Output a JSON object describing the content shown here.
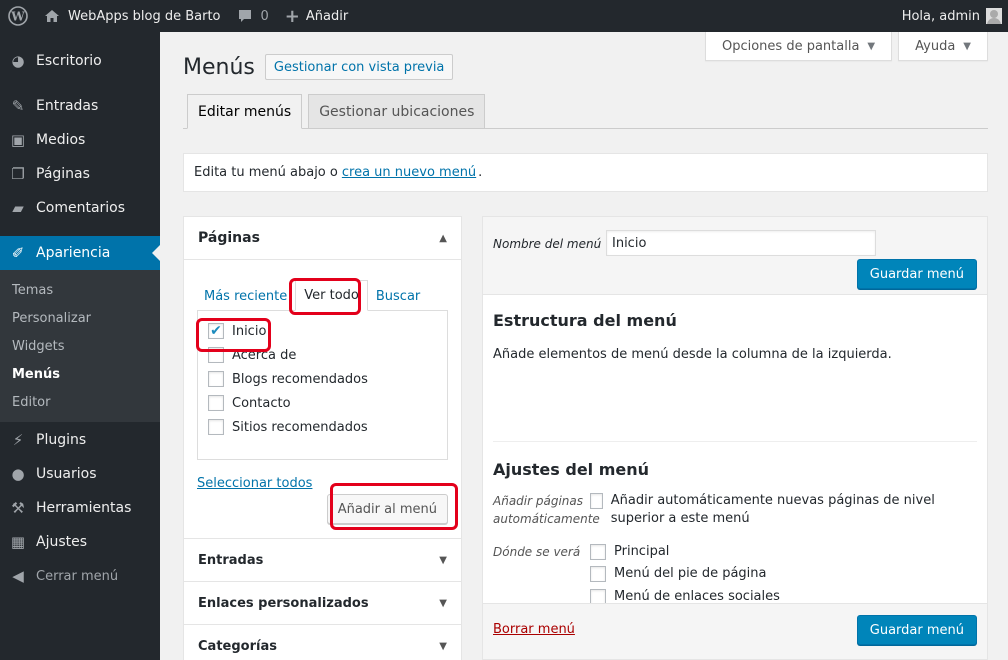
{
  "adminbar": {
    "site_name": "WebApps blog de Barto",
    "comments_count": "0",
    "new_label": "Añadir",
    "greeting": "Hola, admin"
  },
  "sidebar": {
    "items": [
      {
        "label": "Escritorio",
        "icon": "dashboard-icon"
      },
      {
        "label": "Entradas",
        "icon": "pin-icon"
      },
      {
        "label": "Medios",
        "icon": "media-icon"
      },
      {
        "label": "Páginas",
        "icon": "pages-icon"
      },
      {
        "label": "Comentarios",
        "icon": "comment-icon"
      },
      {
        "label": "Apariencia",
        "icon": "brush-icon"
      },
      {
        "label": "Plugins",
        "icon": "plugin-icon"
      },
      {
        "label": "Usuarios",
        "icon": "users-icon"
      },
      {
        "label": "Herramientas",
        "icon": "wrench-icon"
      },
      {
        "label": "Ajustes",
        "icon": "settings-icon"
      },
      {
        "label": "Cerrar menú",
        "icon": "collapse-icon"
      }
    ],
    "submenu": [
      "Temas",
      "Personalizar",
      "Widgets",
      "Menús",
      "Editor"
    ]
  },
  "screen_options": "Opciones de pantalla",
  "help": "Ayuda",
  "page_title": "Menús",
  "preview_button": "Gestionar con vista previa",
  "tabs": [
    "Editar menús",
    "Gestionar ubicaciones"
  ],
  "notice": {
    "prefix": "Edita tu menú abajo o",
    "link": "crea un nuevo menú",
    "suffix": "."
  },
  "pages_box": {
    "title": "Páginas",
    "tabs": [
      "Más reciente",
      "Ver todo",
      "Buscar"
    ],
    "items": [
      {
        "label": "Inicio",
        "checked": true
      },
      {
        "label": "Acerca de",
        "checked": false
      },
      {
        "label": "Blogs recomendados",
        "checked": false
      },
      {
        "label": "Contacto",
        "checked": false
      },
      {
        "label": "Sitios recomendados",
        "checked": false
      }
    ],
    "select_all": "Seleccionar todos",
    "add_button": "Añadir al menú"
  },
  "other_boxes": [
    "Entradas",
    "Enlaces personalizados",
    "Categorías"
  ],
  "menu_editor": {
    "name_label": "Nombre del menú",
    "name_value": "Inicio",
    "save_label": "Guardar menú",
    "structure_title": "Estructura del menú",
    "structure_text": "Añade elementos de menú desde la columna de la izquierda.",
    "settings_title": "Ajustes del menú",
    "auto_add_label": "Añadir páginas automáticamente",
    "auto_add_option": "Añadir automáticamente nuevas páginas de nivel superior a este menú",
    "display_label": "Dónde se verá",
    "locations": [
      "Principal",
      "Menú del pie de página",
      "Menú de enlaces sociales"
    ],
    "delete_link": "Borrar menú"
  }
}
